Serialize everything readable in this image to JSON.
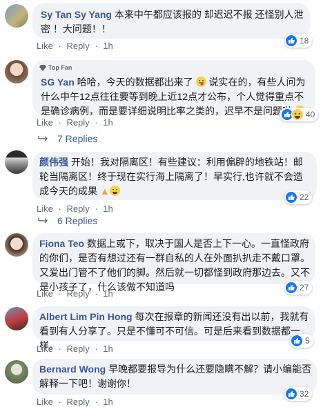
{
  "actions": {
    "like": "Like",
    "reply": "Reply",
    "dot": "·"
  },
  "comments": [
    {
      "name": "Sy Tan Sy Yang",
      "text": "本来中午都应该报的 却迟迟不报 还怪别人泄密 ！大问题！！",
      "time": "1h",
      "reaction_count": "18"
    },
    {
      "badge": "Top Fan",
      "name": "SG Yan",
      "text1": "哈哈，今天的数据都出来了",
      "text2": "说实在的，有些人问为什么中午12点往往要等到晚上近12点才公布，个人觉得重点不是确诊病例，而是要详细说明比率之类的，迟早不是问题啦",
      "time": "1h",
      "reaction_count": "40",
      "replies": "7 Replies"
    },
    {
      "name": "颜伟强",
      "text": "开始！我对隔离区！有些建议：利用偏辟的地铁站！邮轮当隔离区！终于现在实行海上隔离了！早实行,也许就不会造成今天的成果",
      "time": "1h",
      "reaction_count": "22",
      "replies": "6 Replies"
    },
    {
      "name": "Fiona Teo",
      "text": "数据上或下，取决于国人是否上下一心。一直怪政府的你们，是否有想过还有一群自私的人在外面扒扒走不戴口罩。又爱出门管不了他们的脚。然后就一切都怪到政府那边去。又不是小孩子了，什么该做不知道吗",
      "time": "1h",
      "reaction_count": "27"
    },
    {
      "name": "Albert Lim Pin Hong",
      "text": "每次在报章的新闻还没有出以前，我就有看到有人分享了。只是不懂可不可信。可是后来看到数据都一样。",
      "time": "1h",
      "reaction_count": "5"
    },
    {
      "name": "Bernard Wong",
      "text": "早晚都要报导为什么还要隐瞒不解？请小编能否解释一下吧！谢谢你！",
      "time": "1h",
      "reaction_count": "32"
    }
  ],
  "colors": {
    "link": "#385898",
    "like": "#1877f2",
    "bubble": "#f0f2f5"
  }
}
